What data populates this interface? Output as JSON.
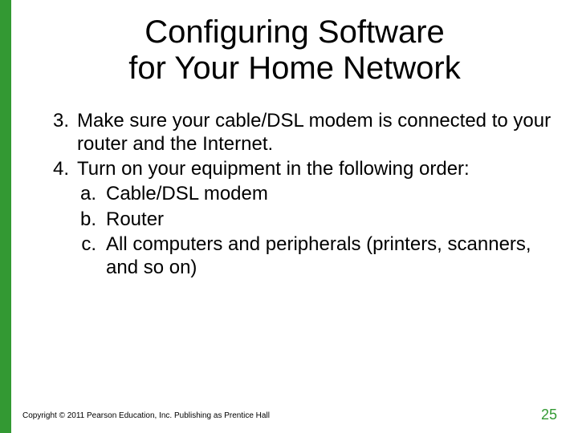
{
  "title_line1": "Configuring Software",
  "title_line2": "for Your Home Network",
  "items": [
    {
      "marker": "3.",
      "text": "Make sure your cable/DSL modem is connected to your router and the Internet."
    },
    {
      "marker": "4.",
      "text": "Turn on your equipment in the following order:"
    }
  ],
  "subitems": [
    {
      "marker": "a.",
      "text": "Cable/DSL modem"
    },
    {
      "marker": "b.",
      "text": "Router"
    },
    {
      "marker": "c.",
      "text": "All computers and peripherals (printers, scanners, and so on)"
    }
  ],
  "footer": "Copyright © 2011 Pearson Education, Inc. Publishing as Prentice Hall",
  "page_number": "25"
}
